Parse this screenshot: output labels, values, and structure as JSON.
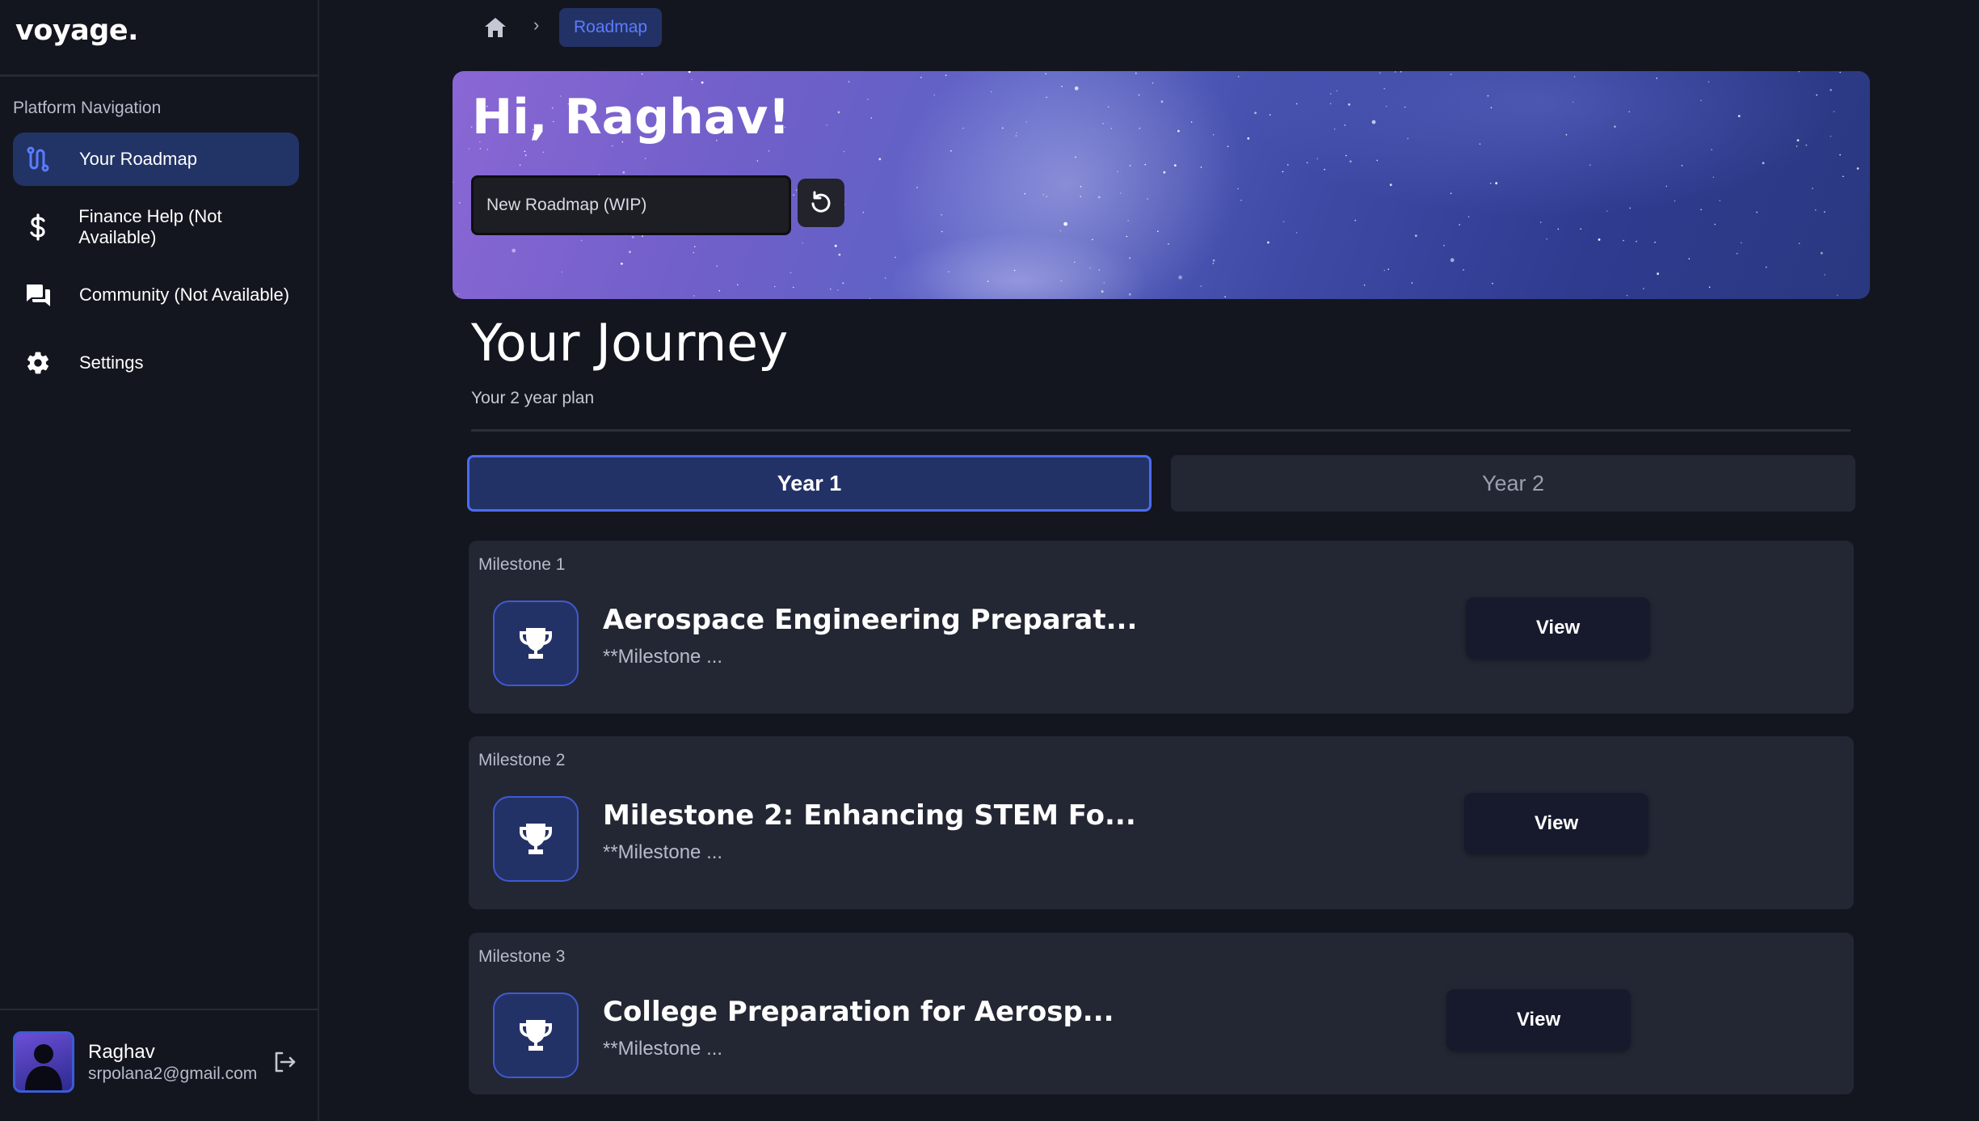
{
  "app": {
    "brand": "voyage."
  },
  "sidebar": {
    "nav_title": "Platform Navigation",
    "items": [
      {
        "label": "Your Roadmap",
        "icon": "route-icon",
        "active": true
      },
      {
        "label": "Finance Help (Not Available)",
        "icon": "dollar-icon",
        "active": false
      },
      {
        "label": "Community (Not Available)",
        "icon": "chat-icon",
        "active": false
      },
      {
        "label": "Settings",
        "icon": "gear-icon",
        "active": false
      }
    ],
    "profile": {
      "name": "Raghav",
      "email": "srpolana2@gmail.com"
    }
  },
  "breadcrumb": {
    "current": "Roadmap"
  },
  "hero": {
    "greeting": "Hi, Raghav!",
    "input_placeholder": "New Roadmap (WIP)"
  },
  "journey": {
    "title": "Your Journey",
    "subtitle": "Your 2 year plan",
    "tabs": [
      {
        "label": "Year 1",
        "active": true
      },
      {
        "label": "Year 2",
        "active": false
      }
    ]
  },
  "milestones": [
    {
      "label": "Milestone 1",
      "title": "Aerospace Engineering Preparat...",
      "description": "**Milestone ...",
      "button": "View"
    },
    {
      "label": "Milestone 2",
      "title": "Milestone 2: Enhancing STEM Fo...",
      "description": "**Milestone ...",
      "button": "View"
    },
    {
      "label": "Milestone 3",
      "title": "College Preparation for Aerosp...",
      "description": "**Milestone ...",
      "button": "View"
    }
  ],
  "colors": {
    "background": "#14161f",
    "accent": "#4a6cf0",
    "active_bg": "#223366",
    "card_bg": "#232733"
  }
}
